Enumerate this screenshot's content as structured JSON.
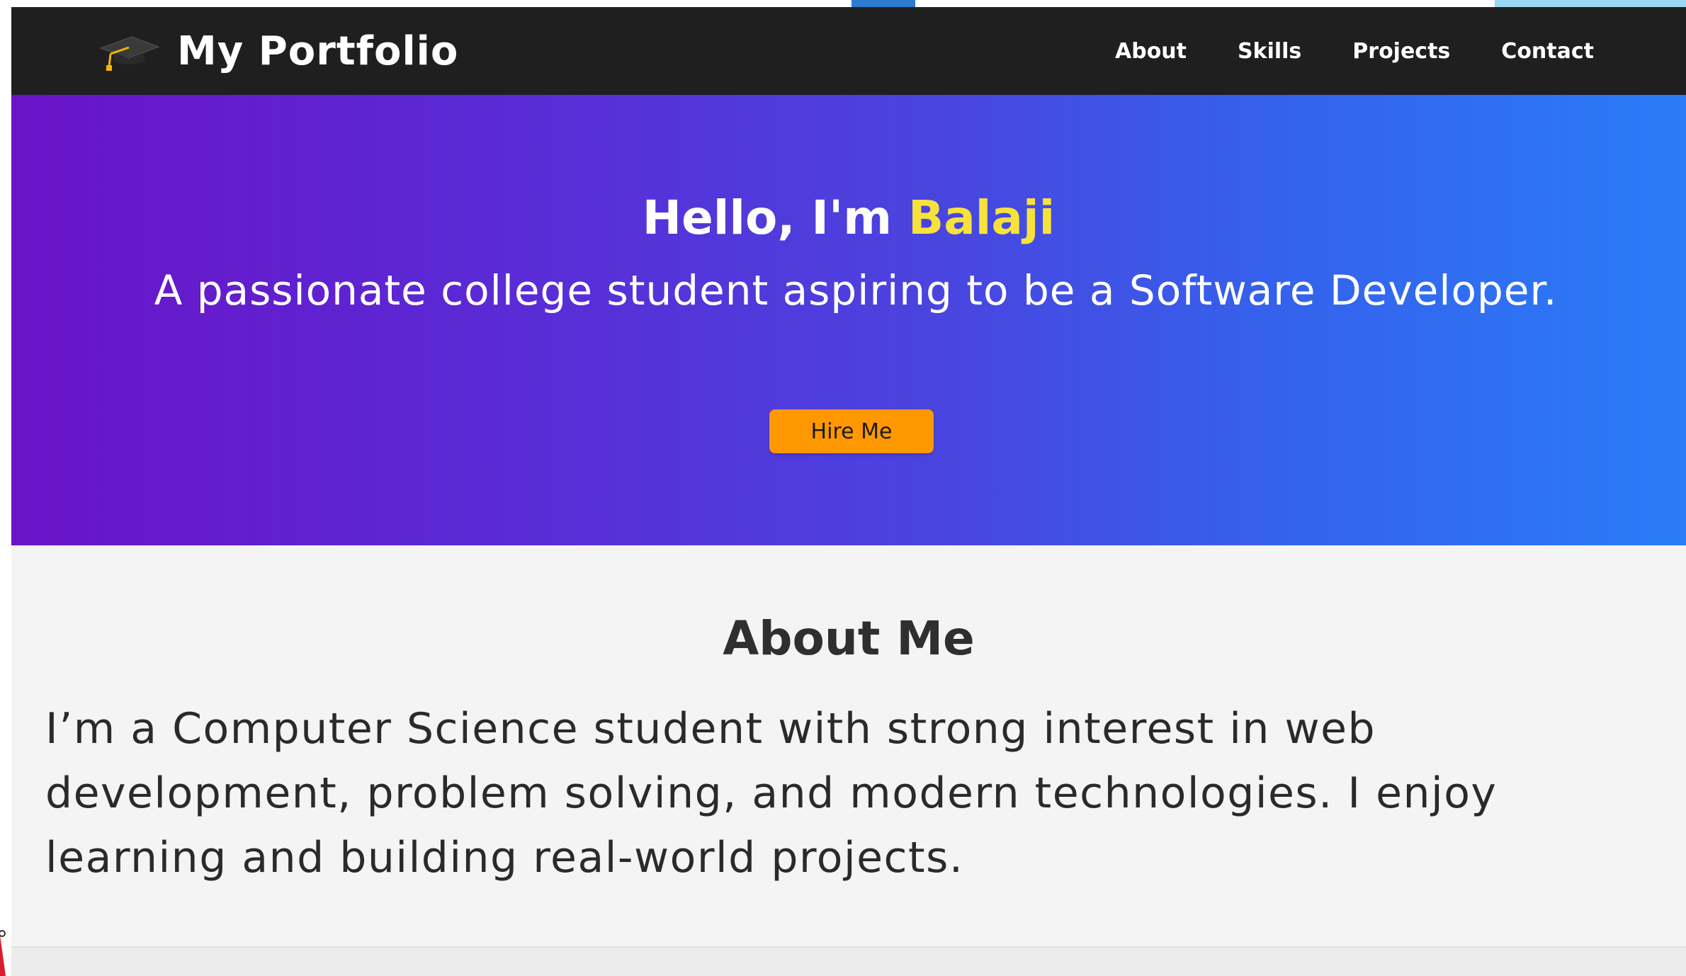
{
  "header": {
    "brand_icon": "graduation-cap-icon",
    "brand_title": "My Portfolio",
    "nav_links": [
      {
        "label": "About"
      },
      {
        "label": "Skills"
      },
      {
        "label": "Projects"
      },
      {
        "label": "Contact"
      }
    ]
  },
  "hero": {
    "greeting": "Hello, I'm",
    "name": "Balaji",
    "tagline": "A passionate college student aspiring to be a Software Developer.",
    "cta_label": "Hire Me"
  },
  "about": {
    "title": "About Me",
    "text": "I’m a Computer Science student with strong interest in web development, problem solving, and modern technologies. I enjoy learning and building real-world projects."
  },
  "colors": {
    "nav_bg": "#1f1f1f",
    "hero_gradient_start": "#6a13c7",
    "hero_gradient_end": "#2a7cf7",
    "name_highlight": "#f7e23c",
    "cta_bg": "#ff9800",
    "about_bg": "#f4f4f4"
  }
}
